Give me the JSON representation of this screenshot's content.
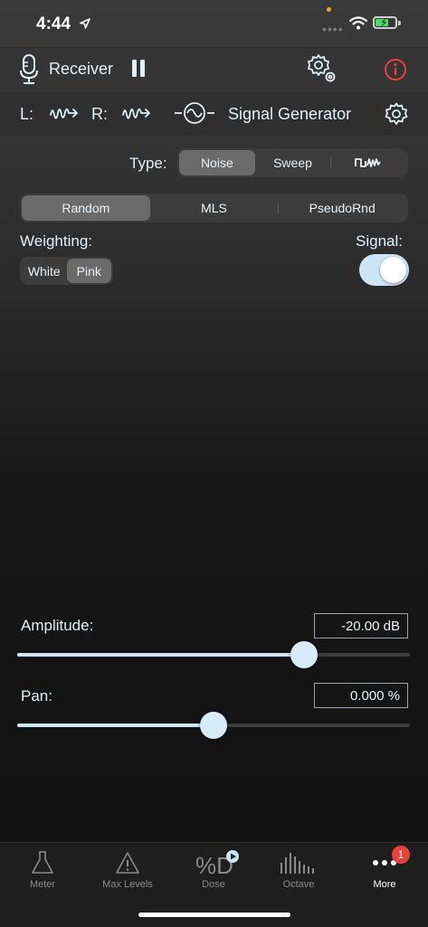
{
  "status_bar": {
    "time": "4:44"
  },
  "toolbar": {
    "receiver_label": "Receiver"
  },
  "channels": {
    "left_label": "L:",
    "right_label": "R:",
    "generator_label": "Signal Generator"
  },
  "type": {
    "label": "Type:",
    "options": [
      "Noise",
      "Sweep"
    ],
    "selected": "Noise"
  },
  "noise_mode": {
    "options": [
      "Random",
      "MLS",
      "PseudoRnd"
    ],
    "selected": "Random"
  },
  "weighting": {
    "label": "Weighting:",
    "options": [
      "White",
      "Pink"
    ],
    "selected": "Pink"
  },
  "signal": {
    "label": "Signal:",
    "on": true
  },
  "amplitude": {
    "label": "Amplitude:",
    "value": "-20.00 dB",
    "level": 0.73
  },
  "pan": {
    "label": "Pan:",
    "value": "0.000 %",
    "level": 0.5
  },
  "tabs": [
    {
      "label": "Meter",
      "icon": "flask-icon"
    },
    {
      "label": "Max Levels",
      "icon": "warning-icon"
    },
    {
      "label": "Dose",
      "icon": "dose-icon"
    },
    {
      "label": "Octave",
      "icon": "octave-bars-icon"
    },
    {
      "label": "More",
      "icon": "more-icon",
      "badge": "1",
      "active": true
    }
  ],
  "colors": {
    "accent": "#cde6f5",
    "alert": "#e8413a"
  }
}
